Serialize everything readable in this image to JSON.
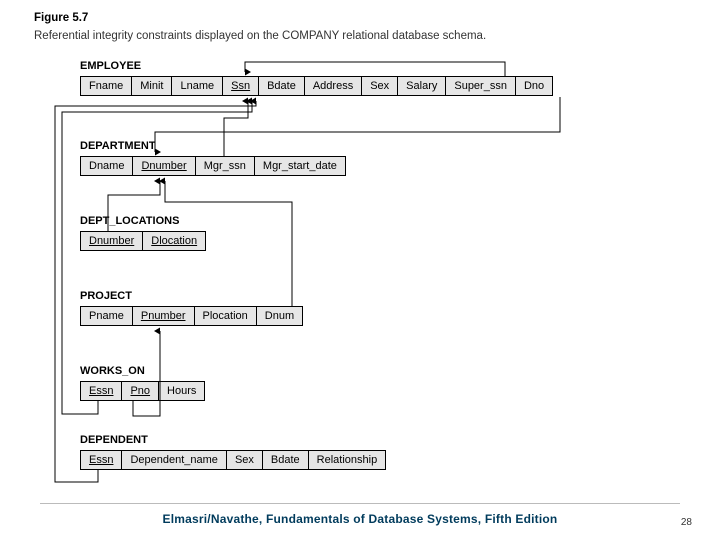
{
  "figure": {
    "title": "Figure 5.7",
    "caption": "Referential integrity constraints displayed on the COMPANY relational database schema."
  },
  "tables": {
    "employee": {
      "name": "EMPLOYEE",
      "cols": {
        "fname": "Fname",
        "minit": "Minit",
        "lname": "Lname",
        "ssn": "Ssn",
        "bdate": "Bdate",
        "address": "Address",
        "sex": "Sex",
        "salary": "Salary",
        "super_ssn": "Super_ssn",
        "dno": "Dno"
      }
    },
    "department": {
      "name": "DEPARTMENT",
      "cols": {
        "dname": "Dname",
        "dnumber": "Dnumber",
        "mgr_ssn": "Mgr_ssn",
        "mgr_start_date": "Mgr_start_date"
      }
    },
    "dept_locations": {
      "name": "DEPT_LOCATIONS",
      "cols": {
        "dnumber": "Dnumber",
        "dlocation": "Dlocation"
      }
    },
    "project": {
      "name": "PROJECT",
      "cols": {
        "pname": "Pname",
        "pnumber": "Pnumber",
        "plocation": "Plocation",
        "dnum": "Dnum"
      }
    },
    "works_on": {
      "name": "WORKS_ON",
      "cols": {
        "essn": "Essn",
        "pno": "Pno",
        "hours": "Hours"
      }
    },
    "dependent": {
      "name": "DEPENDENT",
      "cols": {
        "essn": "Essn",
        "dependent_name": "Dependent_name",
        "sex": "Sex",
        "bdate": "Bdate",
        "relationship": "Relationship"
      }
    }
  },
  "footer": {
    "text": "Elmasri/Navathe, Fundamentals of Database Systems, Fifth Edition",
    "page": "28"
  }
}
